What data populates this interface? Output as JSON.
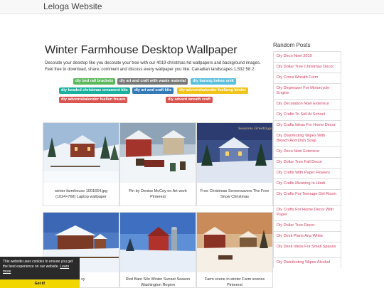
{
  "header": {
    "brand": "Leloga Website"
  },
  "main": {
    "title": "Winter Farmhouse Desktop Wallpaper",
    "description": "Decorate your desktop like you decorate your tree with our 4019 christmas hd wallpapers and background images. Feel free to download, share, comment and discuss every wallpaper you like. Canadian landscapes 1,532 58 2.",
    "tags": [
      {
        "label": "diy bed rail brackets",
        "color": "#5cb85c"
      },
      {
        "label": "diy art and craft with waste material",
        "color": "#777777"
      },
      {
        "label": "diy barang bekas unik",
        "color": "#5bc0de"
      },
      {
        "label": "diy beaded christmas ornament kits",
        "color": "#1ab0a0"
      },
      {
        "label": "diy art and craft kits",
        "color": "#337ab7"
      },
      {
        "label": "diy adventskalender fuellung kinder",
        "color": "#f0c419"
      },
      {
        "label": "diy adventskalender fuellen frauen",
        "color": "#d9534f"
      },
      {
        "label": "diy advent wreath craft",
        "color": "#d9534f"
      }
    ],
    "gallery": [
      {
        "caption": "winter farmhouse 1001664.jpg (1024×768) Laptop wallpaper"
      },
      {
        "caption": "Pin by Denise McCoy on Art work Pinterest"
      },
      {
        "caption": "Free Christmas Screensavers The Free Snow Christmas",
        "image_text": "Seasons Greetings"
      },
      {
        "caption": "…vy"
      },
      {
        "caption": "Red Barn Silo Winter Sunset Season Washington Region"
      },
      {
        "caption": "Farm scene in winter Farm scenes Pinterest"
      }
    ]
  },
  "sidebar": {
    "title": "Random Posts",
    "items": [
      "Diy Deco Noel 2019",
      "Diy Dollar Tree Christmas Decor",
      "Diy Cross Wreath Form",
      "Diy Degreaser For Motorcycle Engine",
      "Diy Decoration Noel Exterieur",
      "Diy Crafts To Sell At School",
      "Diy Crafts Ideas For Home Decor",
      "Diy Disinfecting Wipes With Bleach And Dish Soap",
      "Diy Deco Noel Exterieur",
      "Diy Dollar Tree Fall Decor",
      "Diy Crafts With Paper Flowers",
      "Diy Crafts Meaning In Hindi",
      "Diy Crafts For Teenage Girl Room",
      "Diy Crafts For Home Decor With Paper",
      "Diy Dollar Tree Decor",
      "Diy Desk Plans Ana White",
      "Diy Desk Ideas For Small Spaces",
      "Diy Disinfecting Wipes Alcohol"
    ]
  },
  "cookie": {
    "message": "This website uses cookies to ensure you get the best experience on our website.",
    "link": "Learn more",
    "button": "Got it!"
  }
}
